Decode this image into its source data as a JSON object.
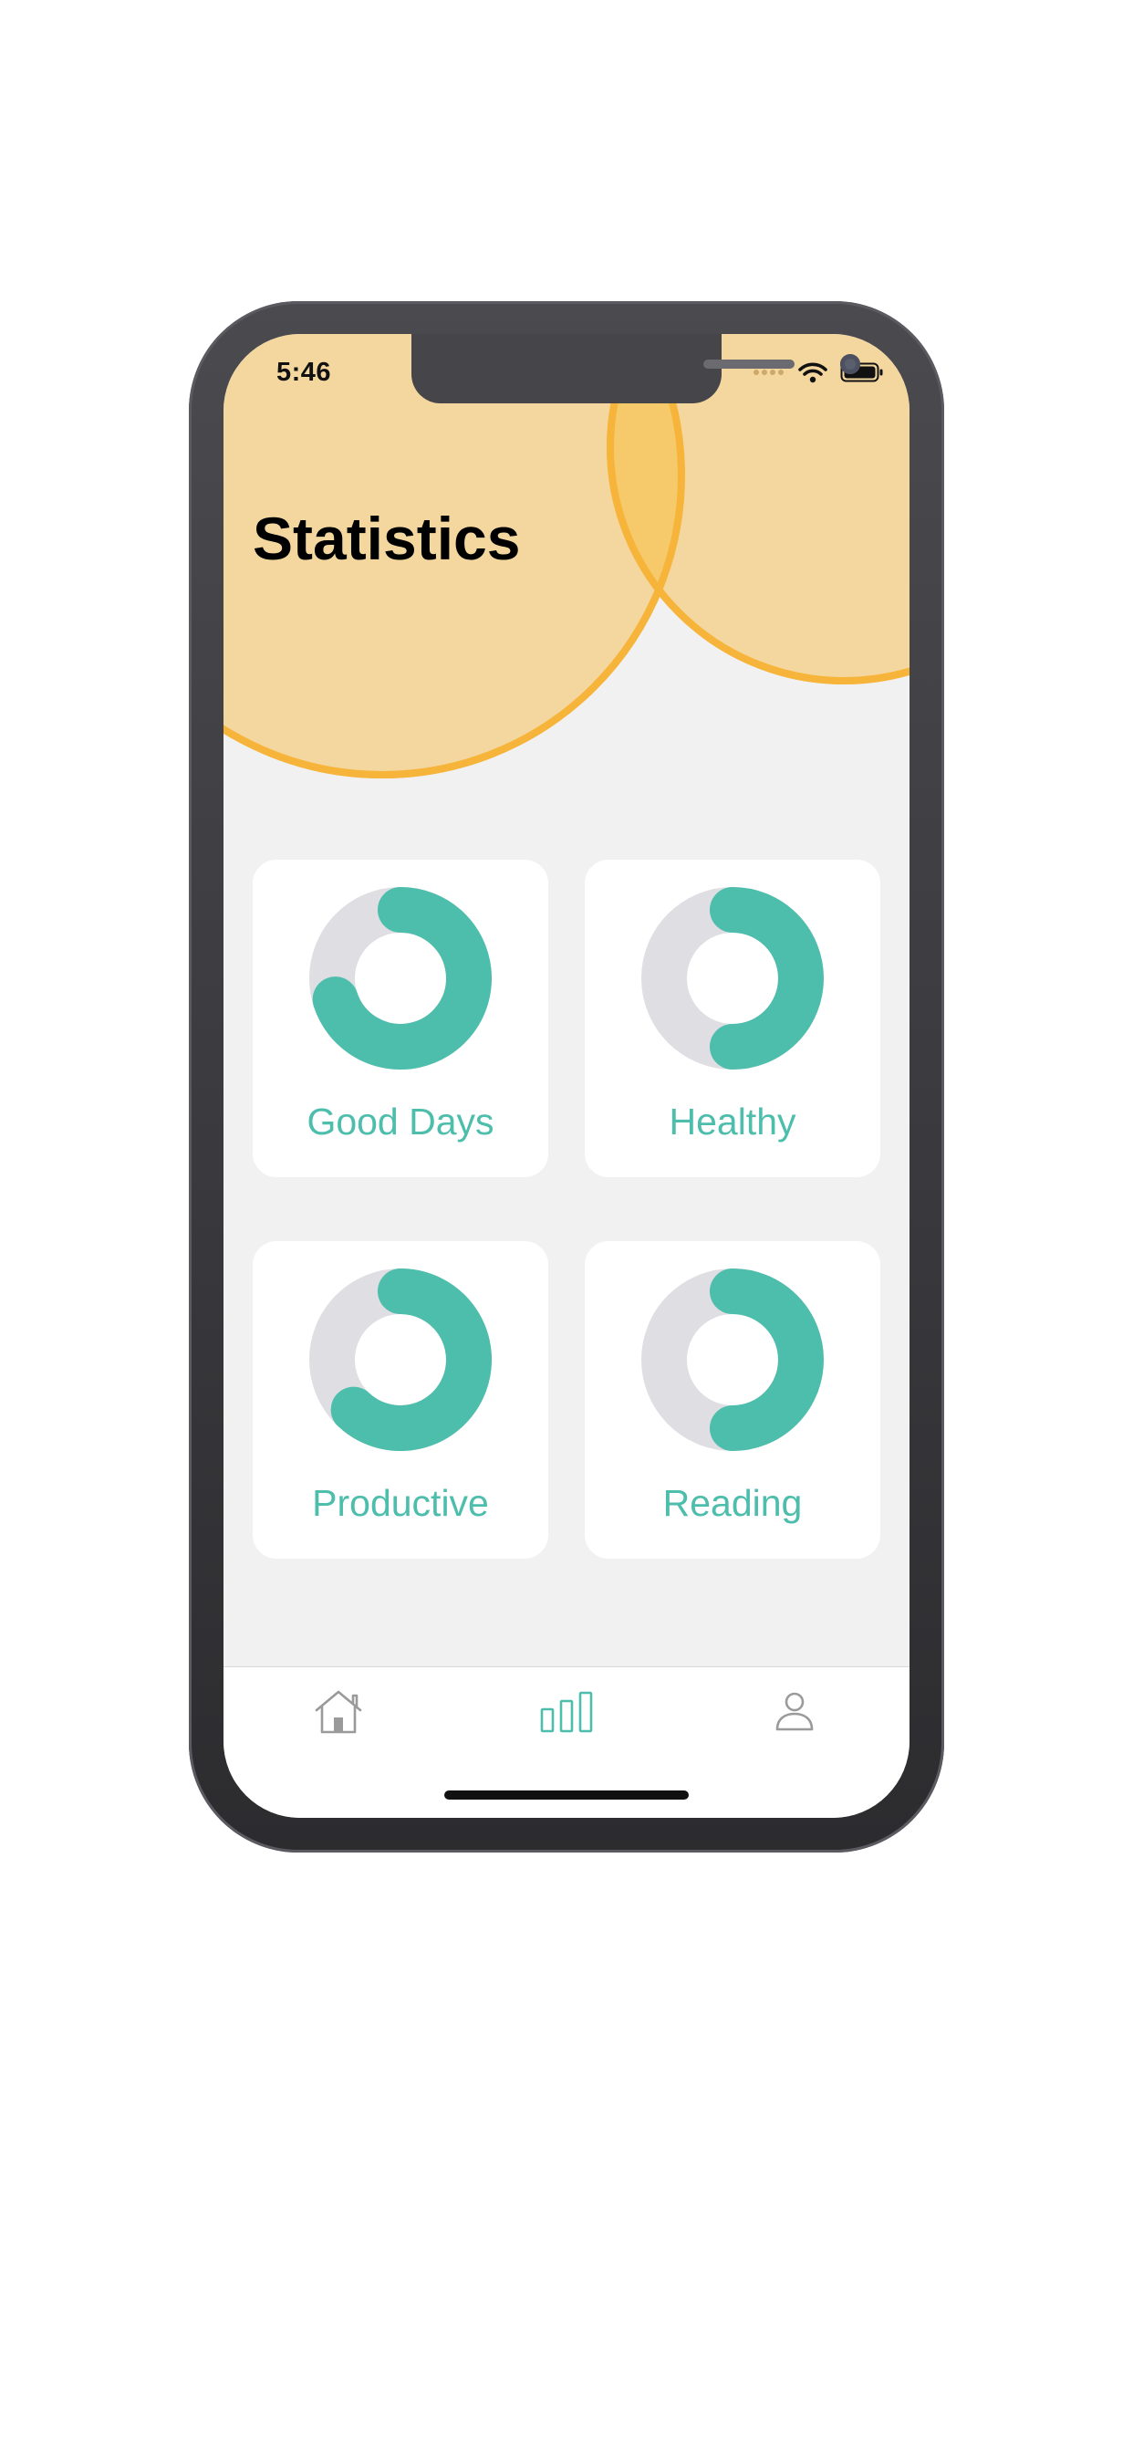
{
  "status_bar": {
    "time": "5:46"
  },
  "header": {
    "title": "Statistics"
  },
  "cards": [
    {
      "label": "Good Days",
      "progress": 0.7
    },
    {
      "label": "Healthy",
      "progress": 0.5
    },
    {
      "label": "Productive",
      "progress": 0.62
    },
    {
      "label": "Reading",
      "progress": 0.5
    }
  ],
  "tabbar": {
    "items": [
      {
        "icon": "home-icon",
        "active": false
      },
      {
        "icon": "bar-chart-icon",
        "active": true
      },
      {
        "icon": "profile-icon",
        "active": false
      }
    ]
  },
  "colors": {
    "accent": "#4dbdac",
    "track": "#dfdee3",
    "header_fill": "#f4d79f",
    "header_stroke": "#f6b53a",
    "background": "#f1f1f1",
    "inactive_icon": "#9a9a9a"
  }
}
